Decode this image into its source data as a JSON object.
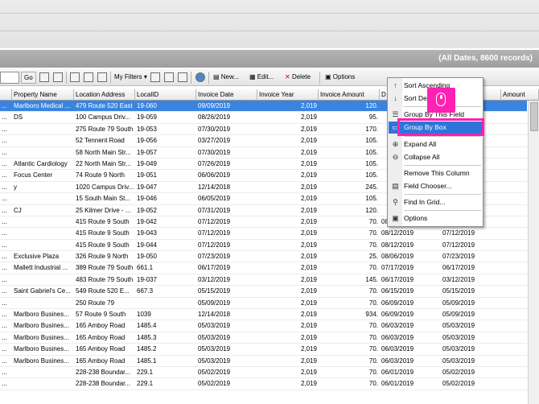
{
  "header": {
    "record_summary": "(All Dates, 8600 records)"
  },
  "toolbar": {
    "go_label": "Go",
    "filters_label": "My Filters",
    "new_label": "New...",
    "edit_label": "Edit...",
    "delete_label": "Delete",
    "options_label": "Options"
  },
  "grid": {
    "columns": [
      "Property Name",
      "Location Address",
      "LocalID",
      "Invoice Date",
      "Invoice Year",
      "Invoice Amount",
      "D",
      "Amount"
    ],
    "rows": [
      [
        "Marlboro Medical ...",
        "479 Route 520 East",
        "19-060",
        "09/09/2019",
        "2,019",
        "120.",
        "",
        ""
      ],
      [
        "DS",
        "100 Campus Driv...",
        "19-059",
        "08/26/2019",
        "2,019",
        "95.",
        "",
        ""
      ],
      [
        "",
        "275 Route 79 South",
        "19-053",
        "07/30/2019",
        "2,019",
        "170.",
        "",
        ""
      ],
      [
        "",
        "52 Tennent Road",
        "19-056",
        "03/27/2019",
        "2,019",
        "105.",
        "",
        ""
      ],
      [
        "",
        "58 North Main Str...",
        "19-057",
        "07/30/2019",
        "2,019",
        "105.",
        "",
        ""
      ],
      [
        "Atlantic Cardiology",
        "22 North Main Str...",
        "19-049",
        "07/26/2019",
        "2,019",
        "105.",
        "",
        ""
      ],
      [
        "Focus Center",
        "74 Route 9 North",
        "19-051",
        "06/06/2019",
        "2,019",
        "105.",
        "",
        ""
      ],
      [
        "y",
        "1020 Campus Driv...",
        "19-047",
        "12/14/2018",
        "2,019",
        "245.",
        "",
        ""
      ],
      [
        "",
        "15 South Main St...",
        "19-046",
        "06/05/2019",
        "2,019",
        "105.",
        "",
        ""
      ],
      [
        "CJ",
        "25 Kilmer Drive - ...",
        "19-052",
        "07/31/2019",
        "2,019",
        "120.",
        "",
        ""
      ],
      [
        "",
        "415 Route 9 South",
        "19-042",
        "07/12/2019",
        "2,019",
        "70.",
        "08/12/2019",
        "07/12/2019"
      ],
      [
        "",
        "415 Route 9 South",
        "19-043",
        "07/12/2019",
        "2,019",
        "70.",
        "08/12/2019",
        "07/12/2019"
      ],
      [
        "",
        "415 Route 9 South",
        "19-044",
        "07/12/2019",
        "2,019",
        "70.",
        "08/12/2019",
        "07/12/2019"
      ],
      [
        "Exclusive Plaza",
        "326 Route 9 North",
        "19-050",
        "07/23/2019",
        "2,019",
        "25.",
        "08/06/2019",
        "07/23/2019"
      ],
      [
        "Mallett Industrial ...",
        "389 Route 79 South",
        "661.1",
        "06/17/2019",
        "2,019",
        "70.",
        "07/17/2019",
        "06/17/2019"
      ],
      [
        "",
        "483 Route 79 South",
        "19-037",
        "03/12/2019",
        "2,019",
        "145.",
        "06/17/2019",
        "03/12/2019"
      ],
      [
        "Saint Gabriel's Ce...",
        "549 Route 520 E...",
        "667.3",
        "05/15/2019",
        "2,019",
        "70.",
        "06/15/2019",
        "05/15/2019"
      ],
      [
        "",
        "250 Route 79",
        "",
        "05/09/2019",
        "2,019",
        "70.",
        "06/09/2019",
        "05/09/2019"
      ],
      [
        "Marlboro Busines...",
        "57 Route 9 South",
        "1039",
        "12/14/2018",
        "2,019",
        "934.",
        "06/09/2019",
        "05/09/2019"
      ],
      [
        "Marlboro Busines...",
        "165 Amboy Road",
        "1485.4",
        "05/03/2019",
        "2,019",
        "70.",
        "06/03/2019",
        "05/03/2019"
      ],
      [
        "Marlboro Busines...",
        "165 Amboy Road",
        "1485.3",
        "05/03/2019",
        "2,019",
        "70.",
        "06/03/2019",
        "05/03/2019"
      ],
      [
        "Marlboro Busines...",
        "165 Amboy Road",
        "1485.2",
        "05/03/2019",
        "2,019",
        "70.",
        "06/03/2019",
        "05/03/2019"
      ],
      [
        "Marlboro Busines...",
        "165 Amboy Road",
        "1485.1",
        "05/03/2019",
        "2,019",
        "70.",
        "06/03/2019",
        "05/03/2019"
      ],
      [
        "",
        "228-238 Boundar...",
        "229.1",
        "05/02/2019",
        "2,019",
        "70.",
        "06/01/2019",
        "05/02/2019"
      ],
      [
        "",
        "228-238 Boundar...",
        "229.1",
        "05/02/2019",
        "2,019",
        "70.",
        "06/01/2019",
        "05/02/2019"
      ]
    ]
  },
  "context_menu": {
    "sort_ascending": "Sort Ascending",
    "sort_descending": "Sort Des",
    "group_by_field": "Group By This Field",
    "group_by_box": "Group By Box",
    "expand_all": "Expand All",
    "collapse_all": "Collapse All",
    "remove_column": "Remove This Column",
    "field_chooser": "Field Chooser...",
    "find_in_grid": "Find In Grid...",
    "options": "Options"
  },
  "colors": {
    "selection": "#3a84e0",
    "menu_hover": "#2f74d8",
    "highlight": "#ff1fb0"
  }
}
